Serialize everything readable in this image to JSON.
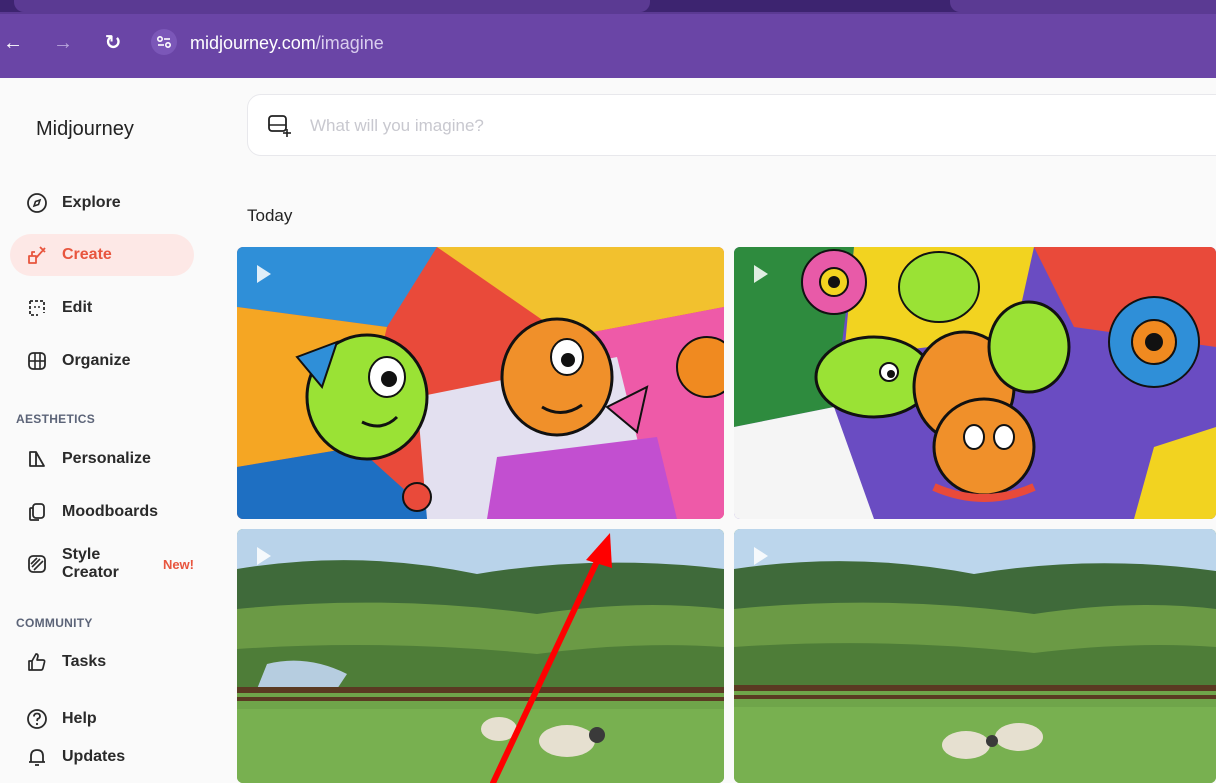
{
  "browser": {
    "url_host": "midjourney.com",
    "url_path": "/imagine",
    "back_glyph": "←",
    "forward_glyph": "→",
    "reload_glyph": "↻"
  },
  "sidebar": {
    "brand": "Midjourney",
    "items": [
      {
        "label": "Explore",
        "icon": "compass-icon"
      },
      {
        "label": "Create",
        "icon": "brush-icon",
        "active": true
      },
      {
        "label": "Edit",
        "icon": "edit-frame-icon"
      },
      {
        "label": "Organize",
        "icon": "grid-icon"
      }
    ],
    "aesthetics_label": "AESTHETICS",
    "aesthetics_items": [
      {
        "label": "Personalize",
        "icon": "personalize-icon"
      },
      {
        "label": "Moodboards",
        "icon": "moodboard-icon"
      },
      {
        "label": "Style Creator",
        "icon": "style-creator-icon",
        "badge": "New!"
      }
    ],
    "community_label": "COMMUNITY",
    "community_items": [
      {
        "label": "Tasks",
        "icon": "thumbs-up-icon"
      },
      {
        "label": "Help",
        "icon": "help-icon"
      },
      {
        "label": "Updates",
        "icon": "bell-icon"
      }
    ]
  },
  "main": {
    "prompt_placeholder": "What will you imagine?",
    "section_title": "Today",
    "images": [
      {
        "name": "fish-illustration-1",
        "kind": "video"
      },
      {
        "name": "fish-illustration-2",
        "kind": "video"
      },
      {
        "name": "sheep-landscape-1",
        "kind": "video"
      },
      {
        "name": "sheep-landscape-2",
        "kind": "video"
      }
    ]
  },
  "colors": {
    "accent": "#e8553e",
    "browser": "#6a45a6",
    "annotation_arrow": "#ff0000"
  }
}
